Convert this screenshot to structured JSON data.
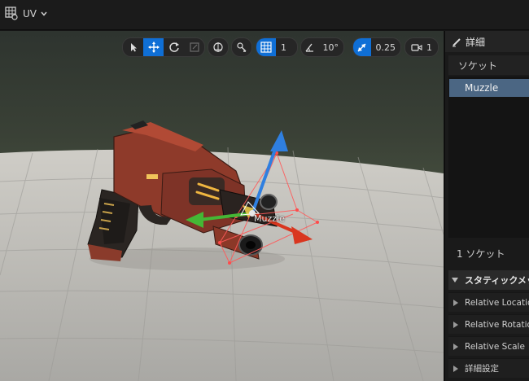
{
  "topbar": {
    "uv_label": "UV"
  },
  "viewport_toolbar": {
    "grid_snap_value": "1",
    "rotation_snap_value": "10°",
    "scale_snap_value": "0.25",
    "camera_speed_value": "1"
  },
  "viewport": {
    "socket_label": "Muzzle"
  },
  "details_panel": {
    "title": "詳細",
    "socket_section_title": "ソケット",
    "sockets": [
      {
        "name": "Muzzle"
      }
    ],
    "socket_count": "1 ソケット",
    "static_mesh_section": "スタティックメッシュソケット",
    "properties": [
      {
        "label": "Relative Location"
      },
      {
        "label": "Relative Rotation"
      },
      {
        "label": "Relative Scale"
      },
      {
        "label": "詳細設定"
      }
    ]
  },
  "colors": {
    "accent_blue": "#0f6fd6",
    "selected_row": "#4b6683",
    "gizmo_x": "#d9361f",
    "gizmo_y": "#45b635",
    "gizmo_z": "#2f7fe0"
  }
}
